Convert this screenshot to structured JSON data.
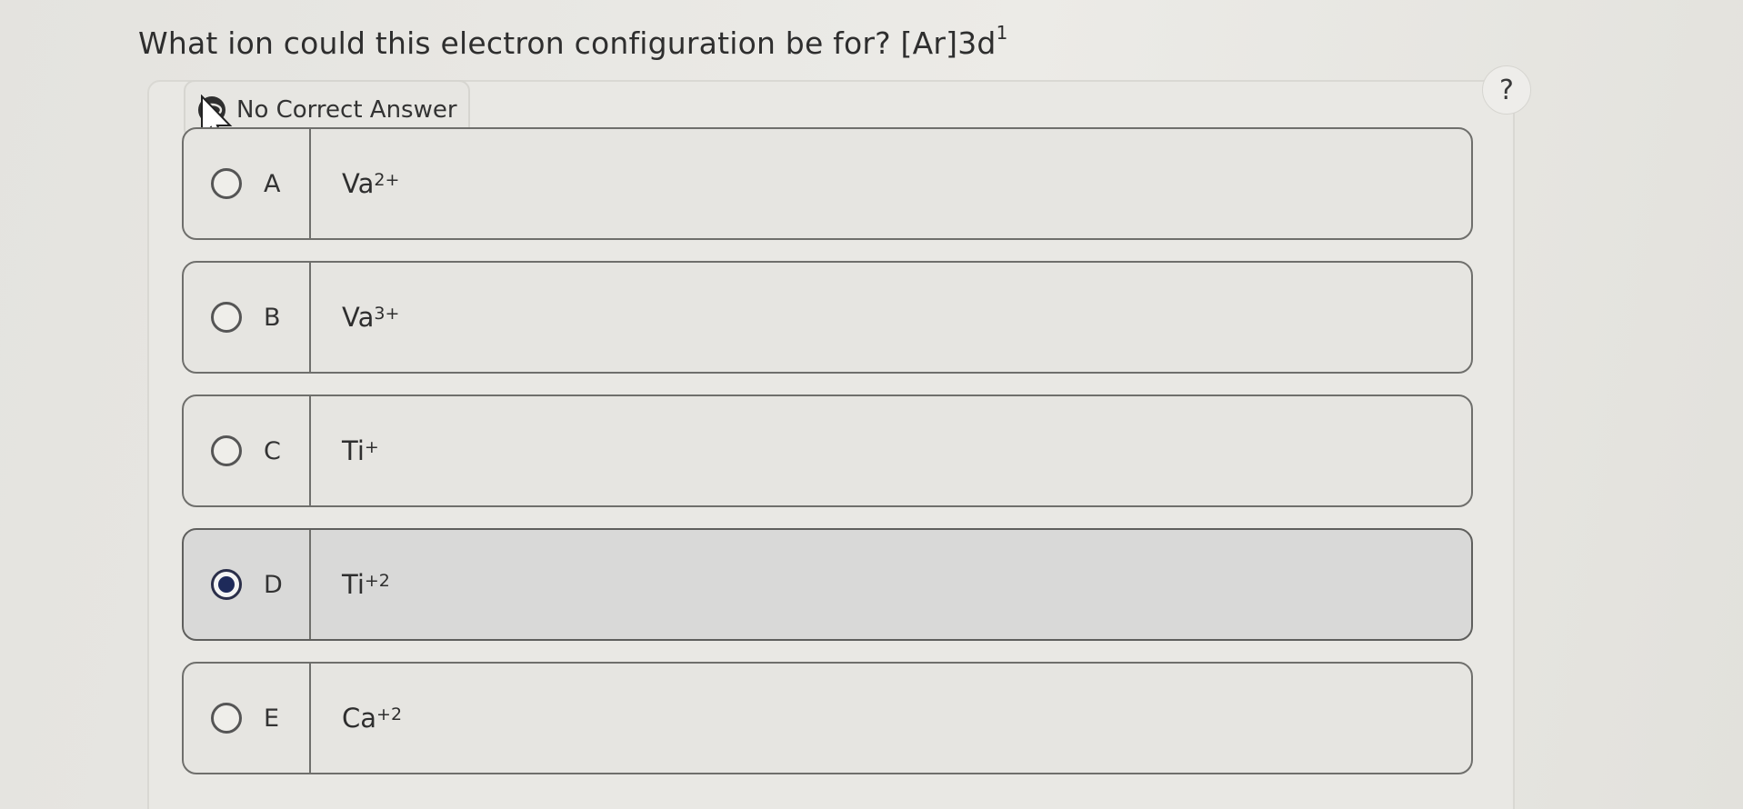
{
  "question": {
    "text": "What ion could this electron configuration be for? [Ar]3d",
    "superscript": "1"
  },
  "help": {
    "label": "?"
  },
  "no_correct_answer": {
    "label": "No Correct Answer"
  },
  "options": [
    {
      "letter": "A",
      "base": "Va",
      "charge": "2+",
      "selected": false
    },
    {
      "letter": "B",
      "base": "Va",
      "charge": "3+",
      "selected": false
    },
    {
      "letter": "C",
      "base": "Ti",
      "charge": "+",
      "selected": false
    },
    {
      "letter": "D",
      "base": "Ti",
      "charge": "+2",
      "selected": true
    },
    {
      "letter": "E",
      "base": "Ca",
      "charge": "+2",
      "selected": false
    }
  ]
}
